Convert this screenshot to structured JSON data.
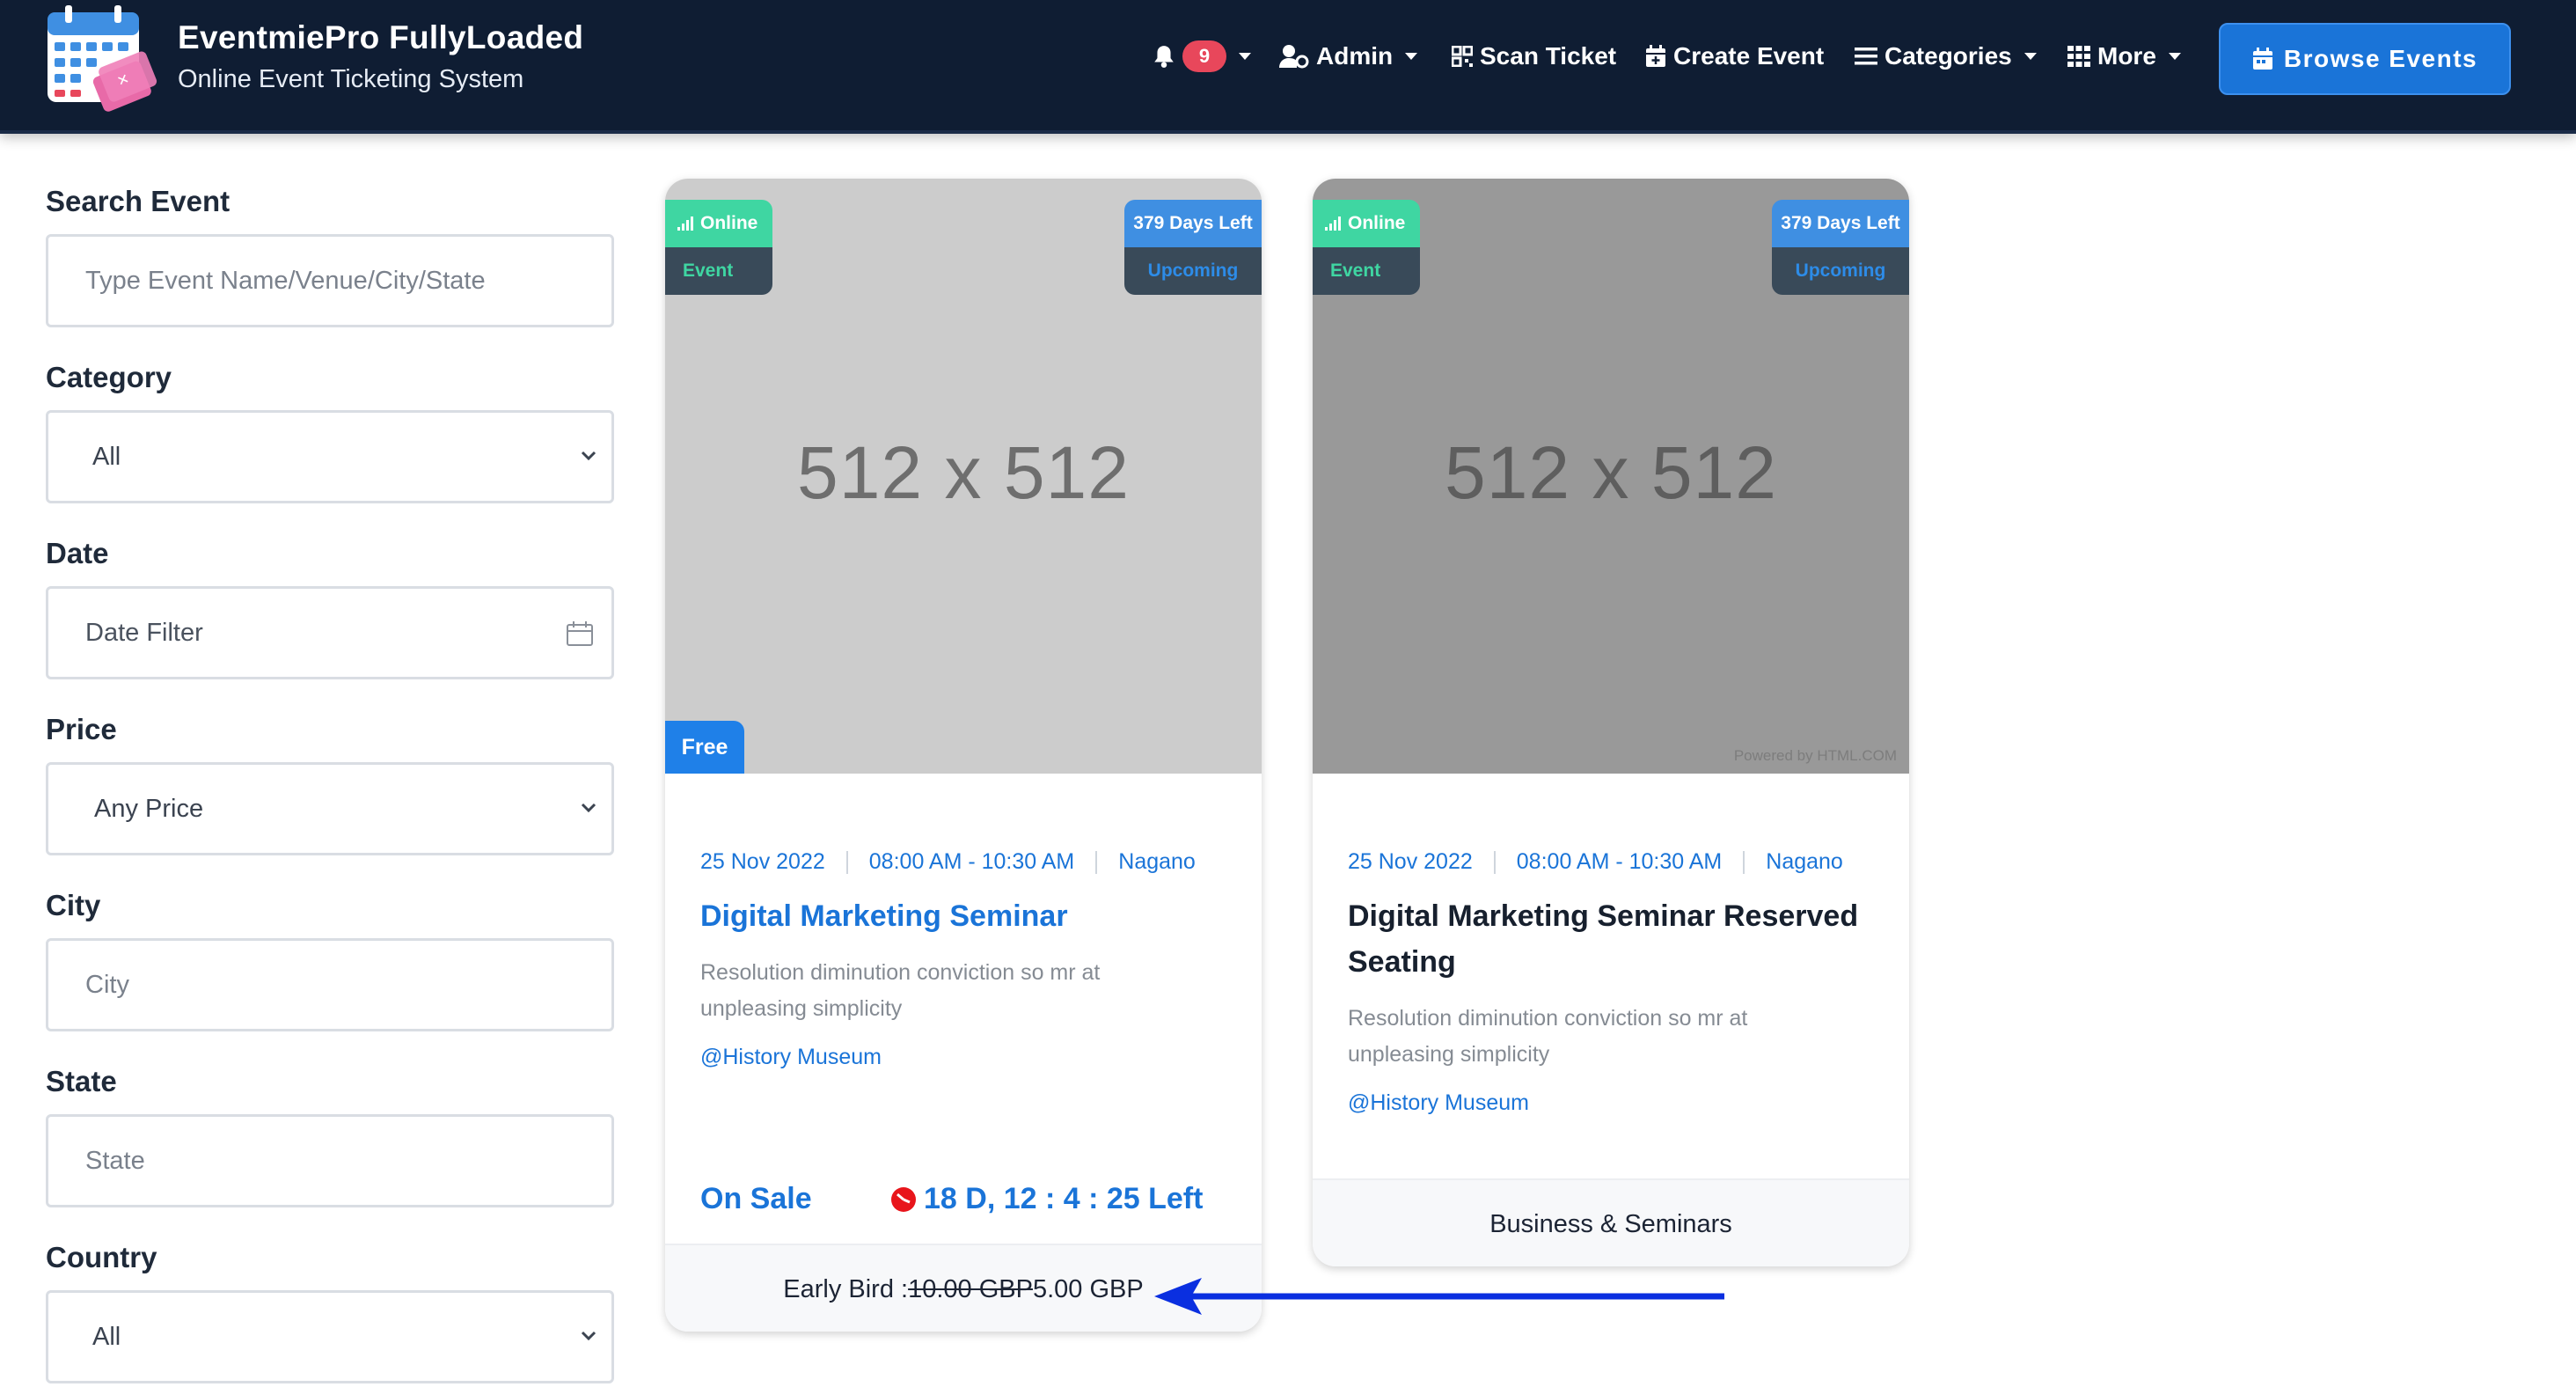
{
  "brand": {
    "title": "EventmiePro FullyLoaded",
    "subtitle": "Online Event Ticketing System"
  },
  "nav": {
    "notification_count": "9",
    "admin": "Admin",
    "scan_ticket": "Scan Ticket",
    "create_event": "Create Event",
    "categories": "Categories",
    "more": "More",
    "browse_events": "Browse Events"
  },
  "filters": {
    "search": {
      "label": "Search Event",
      "placeholder": "Type Event Name/Venue/City/State"
    },
    "category": {
      "label": "Category",
      "value": "All"
    },
    "date": {
      "label": "Date",
      "placeholder": "Date Filter"
    },
    "price": {
      "label": "Price",
      "value": "Any Price"
    },
    "city": {
      "label": "City",
      "placeholder": "City"
    },
    "state": {
      "label": "State",
      "placeholder": "State"
    },
    "country": {
      "label": "Country",
      "value": "All"
    }
  },
  "events": [
    {
      "image_text": "512 x 512",
      "tag_type": "Online",
      "tag_kind": "Event",
      "days_left": "379 Days Left",
      "status": "Upcoming",
      "badge": "Free",
      "date": "25 Nov 2022",
      "time": "08:00 AM - 10:30 AM",
      "city": "Nagano",
      "title": "Digital Marketing Seminar",
      "description": "Resolution diminution conviction so mr at unpleasing simplicity",
      "venue": "@History Museum",
      "sale_status": "On Sale",
      "countdown": "18 D, 12 : 4 : 25 Left",
      "price_label": "Early Bird : ",
      "price_old": "10.00 GBP",
      "price_new": "5.00 GBP"
    },
    {
      "image_text": "512 x 512",
      "tag_type": "Online",
      "tag_kind": "Event",
      "days_left": "379 Days Left",
      "status": "Upcoming",
      "watermark": "Powered by HTML.COM",
      "date": "25 Nov 2022",
      "time": "08:00 AM - 10:30 AM",
      "city": "Nagano",
      "title": "Digital Marketing Seminar Reserved Seating",
      "description": "Resolution diminution conviction so mr at unpleasing simplicity",
      "venue": "@History Museum",
      "category": "Business & Seminars"
    }
  ],
  "colors": {
    "navbar_bg": "#0f1d33",
    "accent_blue": "#1a74d8",
    "online_green": "#3fd6a2",
    "tag_dark": "#394a59",
    "badge_red": "#e8475b",
    "annotation_arrow": "#0a2fe0"
  }
}
